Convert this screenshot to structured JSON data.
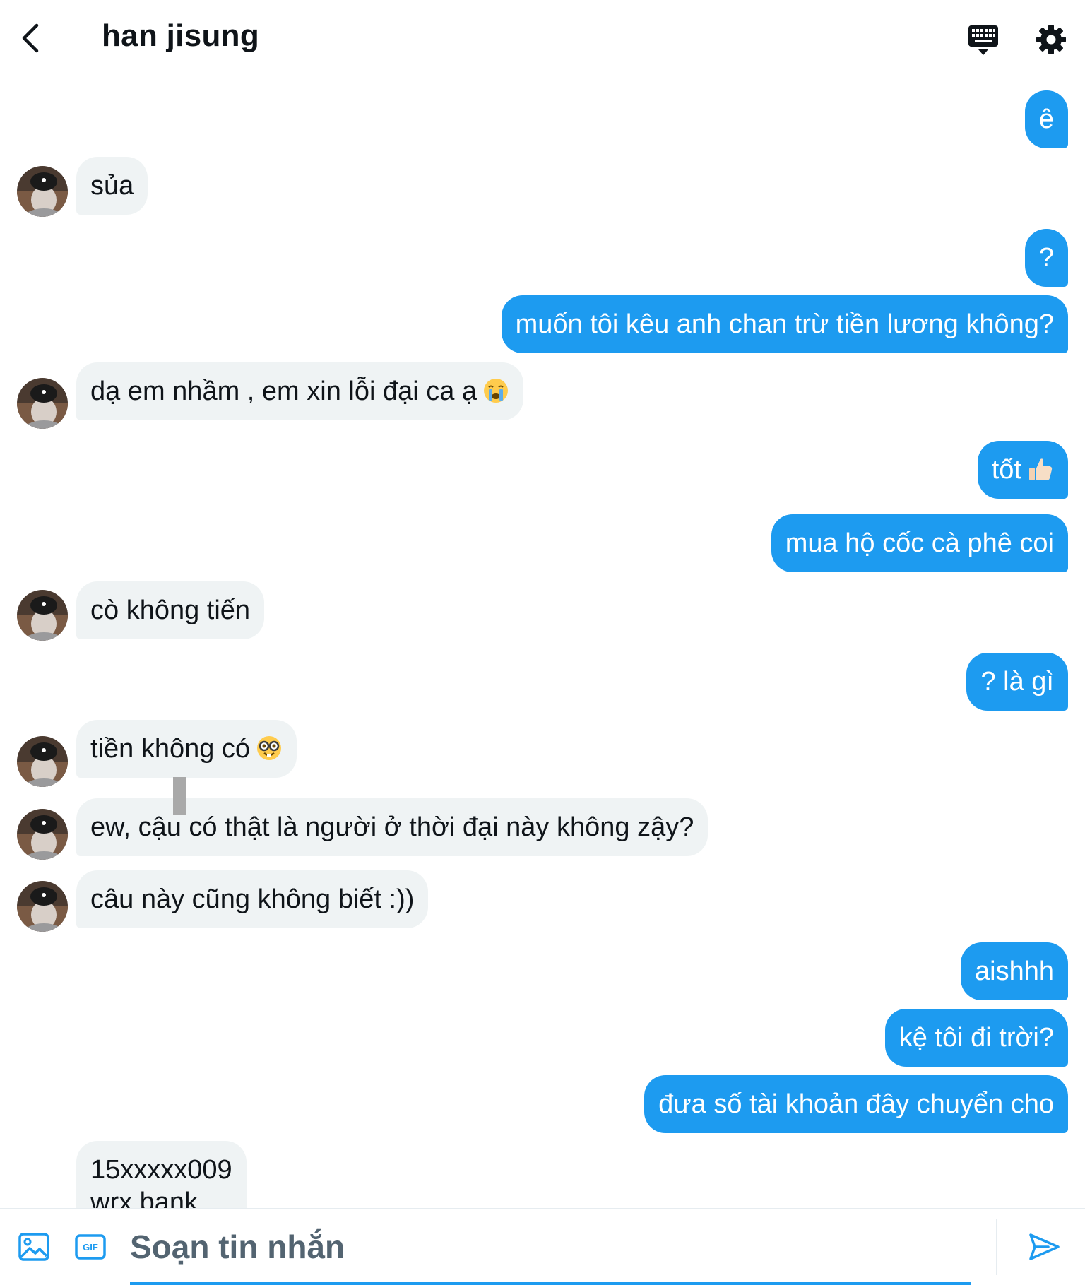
{
  "header": {
    "title": "han jisung",
    "icons": {
      "back": "chevron-left-icon",
      "keyboard": "keyboard-icon",
      "settings": "gear-icon"
    }
  },
  "colors": {
    "accent": "#1d9bf0",
    "incoming_bubble": "#eff3f4",
    "text": "#0f1419",
    "muted": "#536471"
  },
  "messages": [
    {
      "dir": "out",
      "text": "ê"
    },
    {
      "dir": "in",
      "text": "sủa"
    },
    {
      "dir": "out",
      "text": "?"
    },
    {
      "dir": "out",
      "text": "muốn tôi kêu anh chan trừ tiền lương không?"
    },
    {
      "dir": "in",
      "text": "dạ em nhầm , em xin lỗi đại ca ạ",
      "emoji": "loudly-crying-face"
    },
    {
      "dir": "out",
      "text": "tốt",
      "emoji": "thumbs-up"
    },
    {
      "dir": "out",
      "text": "mua hộ cốc cà phê coi"
    },
    {
      "dir": "in",
      "text": "cò không tiến"
    },
    {
      "dir": "out",
      "text": "? là gì"
    },
    {
      "dir": "in",
      "text": "tiền không có",
      "emoji": "nerd-face"
    },
    {
      "dir": "in",
      "text": "ew, cậu có thật là người ở thời đại này không zậy?"
    },
    {
      "dir": "in",
      "text": "câu này cũng không biết :))"
    },
    {
      "dir": "out",
      "text": "aishhh"
    },
    {
      "dir": "out",
      "text": "kệ tôi đi trời?"
    },
    {
      "dir": "out",
      "text": "đưa số tài khoản đây chuyển cho"
    },
    {
      "dir": "in",
      "lines": [
        "15xxxxx009",
        "wrx bank"
      ]
    }
  ],
  "composer": {
    "placeholder": "Soạn tin nhắn",
    "icons": {
      "image": "image-icon",
      "gif": "gif-icon",
      "send": "send-icon"
    },
    "gif_label": "GIF"
  }
}
